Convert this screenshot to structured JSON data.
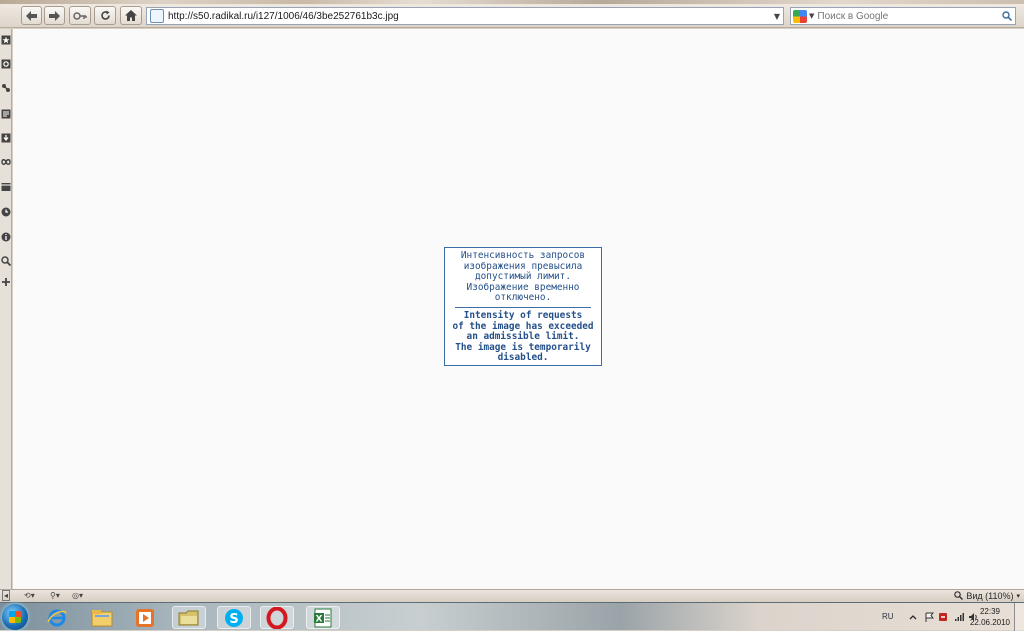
{
  "browser": {
    "url": "http://s50.radikal.ru/i127/1006/46/3be252761b3c.jpg",
    "search_placeholder": "Поиск в Google"
  },
  "error_message": {
    "ru_lines": [
      "Интенсивность запросов",
      "изображения превысила",
      "допустимый лимит.",
      "Изображение временно",
      "отключено."
    ],
    "en_lines": [
      "Intensity of requests",
      "of the image has exceeded",
      "an admissible limit.",
      "The image is temporarily",
      "disabled."
    ]
  },
  "status_bar": {
    "zoom_label": "Вид (110%)"
  },
  "taskbar": {
    "language": "RU",
    "time": "22:39",
    "date": "22.06.2010",
    "apps": [
      "internet-explorer",
      "file-explorer",
      "media-player",
      "folder",
      "skype",
      "opera",
      "excel"
    ]
  },
  "colors": {
    "error_text": "#24508a",
    "error_border": "#3b6ea8"
  }
}
